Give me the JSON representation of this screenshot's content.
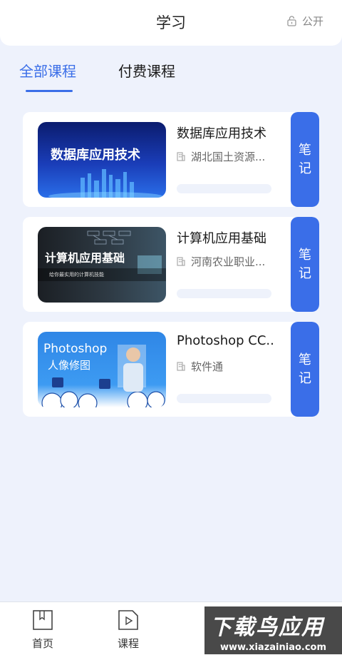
{
  "header": {
    "title": "学习",
    "public_label": "公开"
  },
  "tabs": [
    {
      "label": "全部课程"
    },
    {
      "label": "付费课程"
    }
  ],
  "courses": [
    {
      "title": "数据库应用技术",
      "org": "湖北国土资源...",
      "thumb_text": "数据库应用技术",
      "note_label": [
        "笔",
        "记"
      ]
    },
    {
      "title": "计算机应用基础",
      "org": "河南农业职业...",
      "thumb_text": "计算机应用基础",
      "thumb_sub": "给你最实用的计算机技能",
      "note_label": [
        "笔",
        "记"
      ]
    },
    {
      "title": "Photoshop CC...",
      "org": "软件通",
      "thumb_text": "Photoshop",
      "thumb_sub": "人像修图",
      "note_label": [
        "笔",
        "记"
      ]
    }
  ],
  "bottom_nav": [
    {
      "label": "首页",
      "icon": "book-icon"
    },
    {
      "label": "课程",
      "icon": "play-file-icon"
    }
  ],
  "watermark": {
    "main": "下载鸟应用",
    "url": "www.xiazainiao.com"
  },
  "colors": {
    "accent": "#3a6ee8",
    "background": "#eef2fc"
  }
}
